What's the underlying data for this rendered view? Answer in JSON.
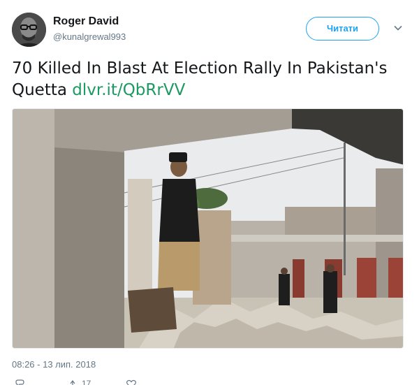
{
  "user": {
    "name": "Roger David",
    "handle": "@kunalgrewal993"
  },
  "follow_label": "Читати",
  "tweet": {
    "text": "70 Killed In Blast At Election Rally In Pakistan's Quetta",
    "link": "dlvr.it/QbRrVV"
  },
  "timestamp": "08:26 - 13 лип. 2018",
  "actions": {
    "retweets": "17"
  }
}
